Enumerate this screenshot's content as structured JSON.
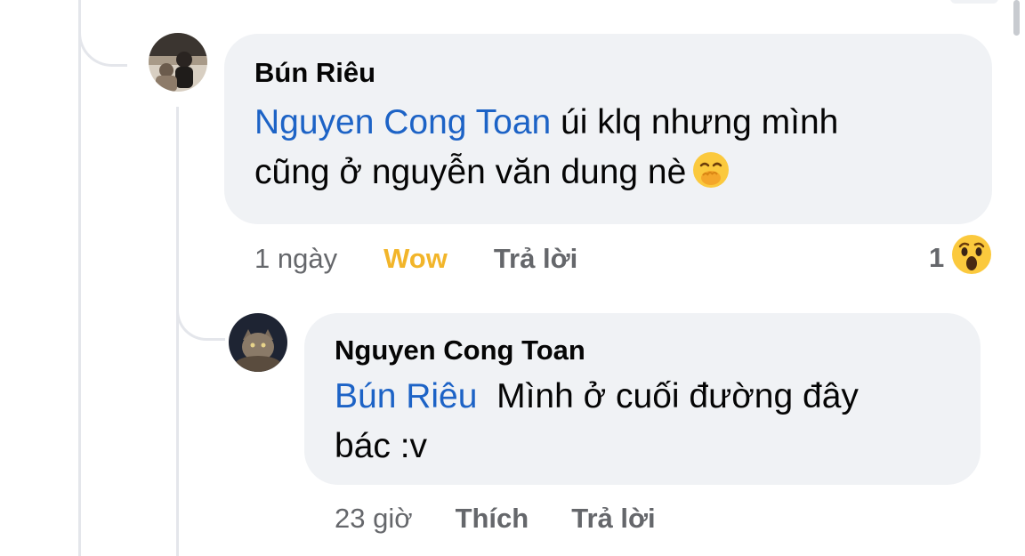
{
  "comments": [
    {
      "author": "Bún Riêu",
      "mention": "Nguyen Cong Toan",
      "text_line1": " úi klq nhưng mình",
      "text_line2": "cũng ở nguyễn văn dung nè",
      "emoji": "face-with-hand-over-mouth",
      "time": "1 ngày",
      "reaction_label": "Wow",
      "reply_label": "Trả lời",
      "reaction_count": "1",
      "reaction_icon": "wow-reaction-icon"
    },
    {
      "author": "Nguyen Cong Toan",
      "mention": "Bún Riêu",
      "text_line1": "  Mình ở cuối đường đây",
      "text_line2": "bác :v",
      "time": "23 giờ",
      "like_label": "Thích",
      "reply_label": "Trả lời"
    }
  ],
  "colors": {
    "bubble": "#f0f2f5",
    "mention": "#1d63c6",
    "wow": "#f2b52a",
    "meta": "#65676b",
    "thread_line": "#e4e6eb"
  }
}
